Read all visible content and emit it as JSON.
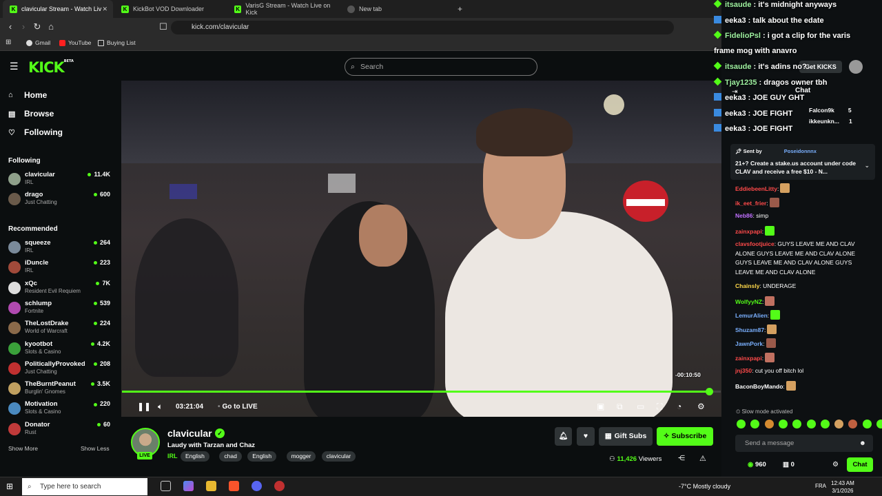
{
  "browser": {
    "tabs": [
      {
        "title": "clavicular Stream - Watch Liv",
        "color": "#53fc18",
        "glyph": "K"
      },
      {
        "title": "KickBot VOD Downloader",
        "color": "#53fc18",
        "glyph": "K"
      },
      {
        "title": "VarisG Stream - Watch Live on Kick",
        "color": "#53fc18",
        "glyph": "K"
      },
      {
        "title": "New tab",
        "color": "#777777",
        "glyph": ""
      }
    ],
    "url": "kick.com/clavicular",
    "bookmarks": [
      "Gmail",
      "YouTube",
      "Buying List"
    ]
  },
  "header": {
    "logo": "KICK",
    "logo_sup": "BETA",
    "search_placeholder": "Search"
  },
  "sidebar": {
    "nav": [
      {
        "label": "Home",
        "icon": "home-icon"
      },
      {
        "label": "Browse",
        "icon": "browse-icon"
      },
      {
        "label": "Following",
        "icon": "heart-icon"
      }
    ],
    "following_title": "Following",
    "following": [
      {
        "name": "clavicular",
        "category": "IRL",
        "viewers": "11.4K",
        "color": "#8fa08a"
      },
      {
        "name": "drago",
        "category": "Just Chatting",
        "viewers": "600",
        "color": "#6a5a4a"
      }
    ],
    "recommended_title": "Recommended",
    "recommended": [
      {
        "name": "squeeze",
        "category": "IRL",
        "viewers": "264",
        "color": "#7a8a9a"
      },
      {
        "name": "iDuncle",
        "category": "IRL",
        "viewers": "223",
        "color": "#a04a3a"
      },
      {
        "name": "xQc",
        "category": "Resident Evil Requiem",
        "viewers": "7K",
        "color": "#dddddd"
      },
      {
        "name": "schlump",
        "category": "Fortnite",
        "viewers": "539",
        "color": "#b04ab0"
      },
      {
        "name": "TheLostDrake",
        "category": "World of Warcraft",
        "viewers": "224",
        "color": "#8a6a4a"
      },
      {
        "name": "kyootbot",
        "category": "Slots & Casino",
        "viewers": "4.2K",
        "color": "#3aa03a"
      },
      {
        "name": "PoliticallyProvoked",
        "category": "Just Chatting",
        "viewers": "208",
        "color": "#c03030"
      },
      {
        "name": "TheBurntPeanut",
        "category": "Burglin' Gnomes",
        "viewers": "3.5K",
        "color": "#c0a060"
      },
      {
        "name": "Motivation",
        "category": "Slots & Casino",
        "viewers": "220",
        "color": "#4a8ac0"
      },
      {
        "name": "Donator",
        "category": "Rust",
        "viewers": "60",
        "color": "#c03a3a"
      }
    ],
    "show_more": "Show More",
    "show_less": "Show Less"
  },
  "player": {
    "time_tooltip": "-00:10:50",
    "timecode": "03:21:04",
    "go_live": "Go to LIVE",
    "progress": 0.98
  },
  "stream": {
    "channel": "clavicular",
    "live": "LIVE",
    "title": "Laudy with Tarzan and Chaz",
    "category": "IRL",
    "tags": [
      "English",
      "chad",
      "English",
      "mogger",
      "clavicular"
    ],
    "gift_subs": "Gift Subs",
    "subscribe": "Subscribe",
    "viewers": "11,426",
    "viewers_label": "Viewers"
  },
  "overlay_chat": [
    {
      "user": "itsaude",
      "text": ": it's midnight anyways",
      "color": "#9ef0a0"
    },
    {
      "user": "eeka3",
      "text": ": talk about the edate",
      "color": "#ffffff"
    },
    {
      "user": "FidelioPsl",
      "text": ": i got a clip for the varis",
      "color": "#9ef0a0"
    },
    {
      "user": "",
      "text": "frame mog with anavro",
      "color": "#ffffff"
    },
    {
      "user": "itsaude",
      "text": ": it's adins no?",
      "color": "#9ef0a0"
    },
    {
      "user": "Tjay1235",
      "text": ": dragos owner tbh",
      "color": "#9ef0a0"
    },
    {
      "user": "eeka3",
      "text": ": JOE GUY GHT",
      "color": "#ffffff"
    },
    {
      "user": "eeka3",
      "text": ": JOE FIGHT",
      "color": "#ffffff"
    },
    {
      "user": "eeka3",
      "text": ": JOE FIGHT",
      "color": "#ffffff"
    }
  ],
  "chat_header": {
    "get_kicks": "Get KICKS",
    "chat_label": "Chat",
    "leaders": [
      {
        "name": "Falcon9k",
        "count": "5"
      },
      {
        "name": "ikkeunkn...",
        "count": "1"
      }
    ]
  },
  "pinned": {
    "sent_by": "Sent by",
    "sender": "Poseidonnnx",
    "message": "21+? Create a stake.us account under code CLAV and receive a free $10 - N..."
  },
  "chat": [
    {
      "user": "EddiebeenLitty",
      "text": ":",
      "color": "#ff4a4a",
      "emote": true
    },
    {
      "user": "ik_eet_frier",
      "text": ":",
      "color": "#ff4a4a",
      "emote": true
    },
    {
      "user": "Neb86",
      "text": ": simp",
      "color": "#c070ff",
      "emote": false
    },
    {
      "user": "zainxpapi",
      "text": ":",
      "color": "#ff4a4a",
      "emote": true
    },
    {
      "user": "clavsfootjuice",
      "text": ": GUYS LEAVE ME AND CLAV ALONE GUYS LEAVE ME AND CLAV ALONE GUYS LEAVE ME AND CLAV ALONE GUYS LEAVE ME AND CLAV ALONE",
      "color": "#ff4a4a",
      "emote": false
    },
    {
      "user": "Chainsly",
      "text": ": UNDERAGE",
      "color": "#ffd84a",
      "emote": false
    },
    {
      "user": "WolfyyNZ",
      "text": ":",
      "color": "#53fc18",
      "emote": true
    },
    {
      "user": "LemurAlien",
      "text": ":",
      "color": "#7ab0ff",
      "emote": true
    },
    {
      "user": "Shuzam87",
      "text": ":",
      "color": "#7ab0ff",
      "emote": true
    },
    {
      "user": "JawnPork",
      "text": ":",
      "color": "#7ab0ff",
      "emote": true
    },
    {
      "user": "zainxpapi",
      "text": ":",
      "color": "#ff4a4a",
      "emote": true
    },
    {
      "user": "jnj350",
      "text": ": cut you off bitch lol",
      "color": "#ff4a4a",
      "emote": false
    },
    {
      "user": "BaconBoyMando",
      "text": ":",
      "color": "#ffffff",
      "emote": true
    }
  ],
  "chat_footer": {
    "slow_mode": "Slow mode activated",
    "placeholder": "Send a message",
    "kicks": "960",
    "points": "0",
    "chat_button": "Chat"
  },
  "taskbar": {
    "search_placeholder": "Type here to search",
    "weather": "-7°C  Mostly cloudy",
    "lang": "FRA",
    "time": "12:43 AM",
    "date": "3/1/2026"
  },
  "colors": {
    "accent": "#53fc18",
    "background": "#0b0e0f"
  }
}
